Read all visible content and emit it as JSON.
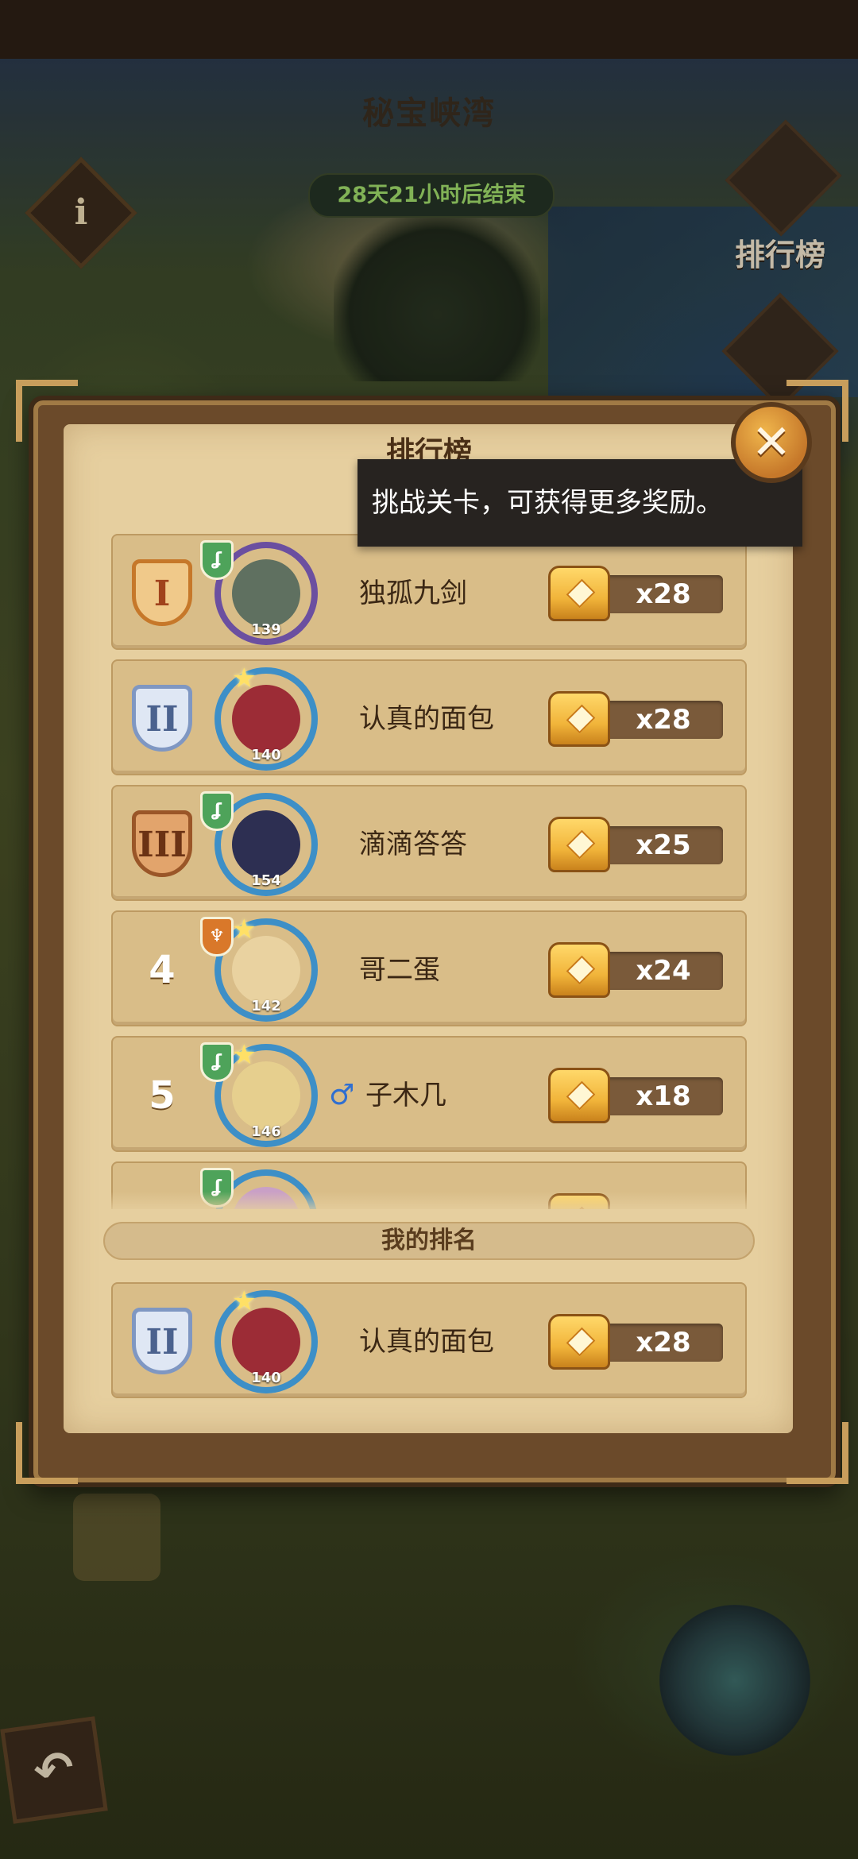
{
  "map": {
    "area_title": "秘宝峡湾",
    "timer": "28天21小时后结束",
    "info_icon": "i",
    "leaderboard_label": "排行榜",
    "back_icon": "back-arrow-icon"
  },
  "modal": {
    "title": "排行榜",
    "close_icon": "close-icon",
    "tooltip": "挑战关卡，可获得更多奖励。",
    "my_rank_label": "我的排名"
  },
  "ranking": [
    {
      "rank": "I",
      "name": "独孤九剑",
      "level": "139",
      "reward": "x28"
    },
    {
      "rank": "II",
      "name": "认真的面包",
      "level": "140",
      "reward": "x28"
    },
    {
      "rank": "III",
      "name": "滴滴答答",
      "level": "154",
      "reward": "x25"
    },
    {
      "rank": "4",
      "name": "哥二蛋",
      "level": "142",
      "reward": "x24"
    },
    {
      "rank": "5",
      "name": "子木几",
      "gender": "♂",
      "level": "146",
      "reward": "x18"
    }
  ],
  "my_ranking": {
    "rank": "II",
    "name": "认真的面包",
    "level": "140",
    "reward": "x28"
  },
  "colors": {
    "gold": "#c6782a",
    "silver": "#9fb4d6",
    "bronze": "#b06a36",
    "green_timer": "#9ed96a",
    "parchment": "#e6cf9f"
  }
}
